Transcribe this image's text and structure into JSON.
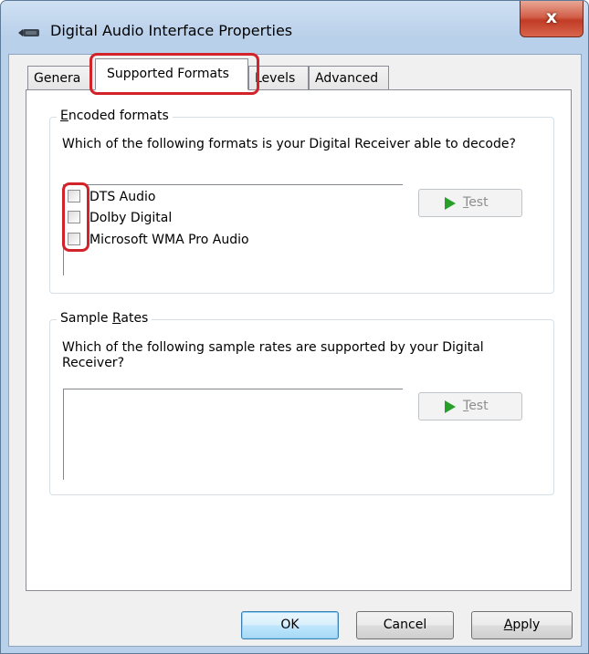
{
  "window": {
    "title": "Digital Audio Interface Properties",
    "close_label": "x",
    "icon": "speaker-device-icon"
  },
  "tabs": [
    {
      "label": "General",
      "shown": "Genera"
    },
    {
      "label": "Supported Formats",
      "selected": true
    },
    {
      "label": "Levels",
      "shown": "Levels"
    },
    {
      "label": "Advanced"
    }
  ],
  "encoded": {
    "title": "Encoded formats",
    "title_access_key": "E",
    "title_rest": "ncoded formats",
    "description": "Which of the following formats is your Digital Receiver able to decode?",
    "formats": [
      {
        "label": "DTS Audio",
        "checked": false
      },
      {
        "label": "Dolby Digital",
        "checked": false
      },
      {
        "label": "Microsoft WMA Pro Audio",
        "checked": false
      }
    ],
    "test_label": "Test",
    "test_access_key": "T",
    "test_rest": "est",
    "test_enabled": false
  },
  "rates": {
    "title": "Sample Rates",
    "title_prefix": "Sample ",
    "title_access_key": "R",
    "title_rest": "ates",
    "description": "Which of the following sample rates are supported by your Digital Receiver?",
    "items": [],
    "test_label": "Test",
    "test_access_key": "T",
    "test_rest": "est",
    "test_enabled": false
  },
  "buttons": {
    "ok": "OK",
    "cancel": "Cancel",
    "apply": "Apply",
    "apply_access_key": "A",
    "apply_rest": "pply"
  },
  "colors": {
    "highlight": "#d3232a",
    "play_icon": "#27a02a",
    "close_button": "#c13b25"
  }
}
